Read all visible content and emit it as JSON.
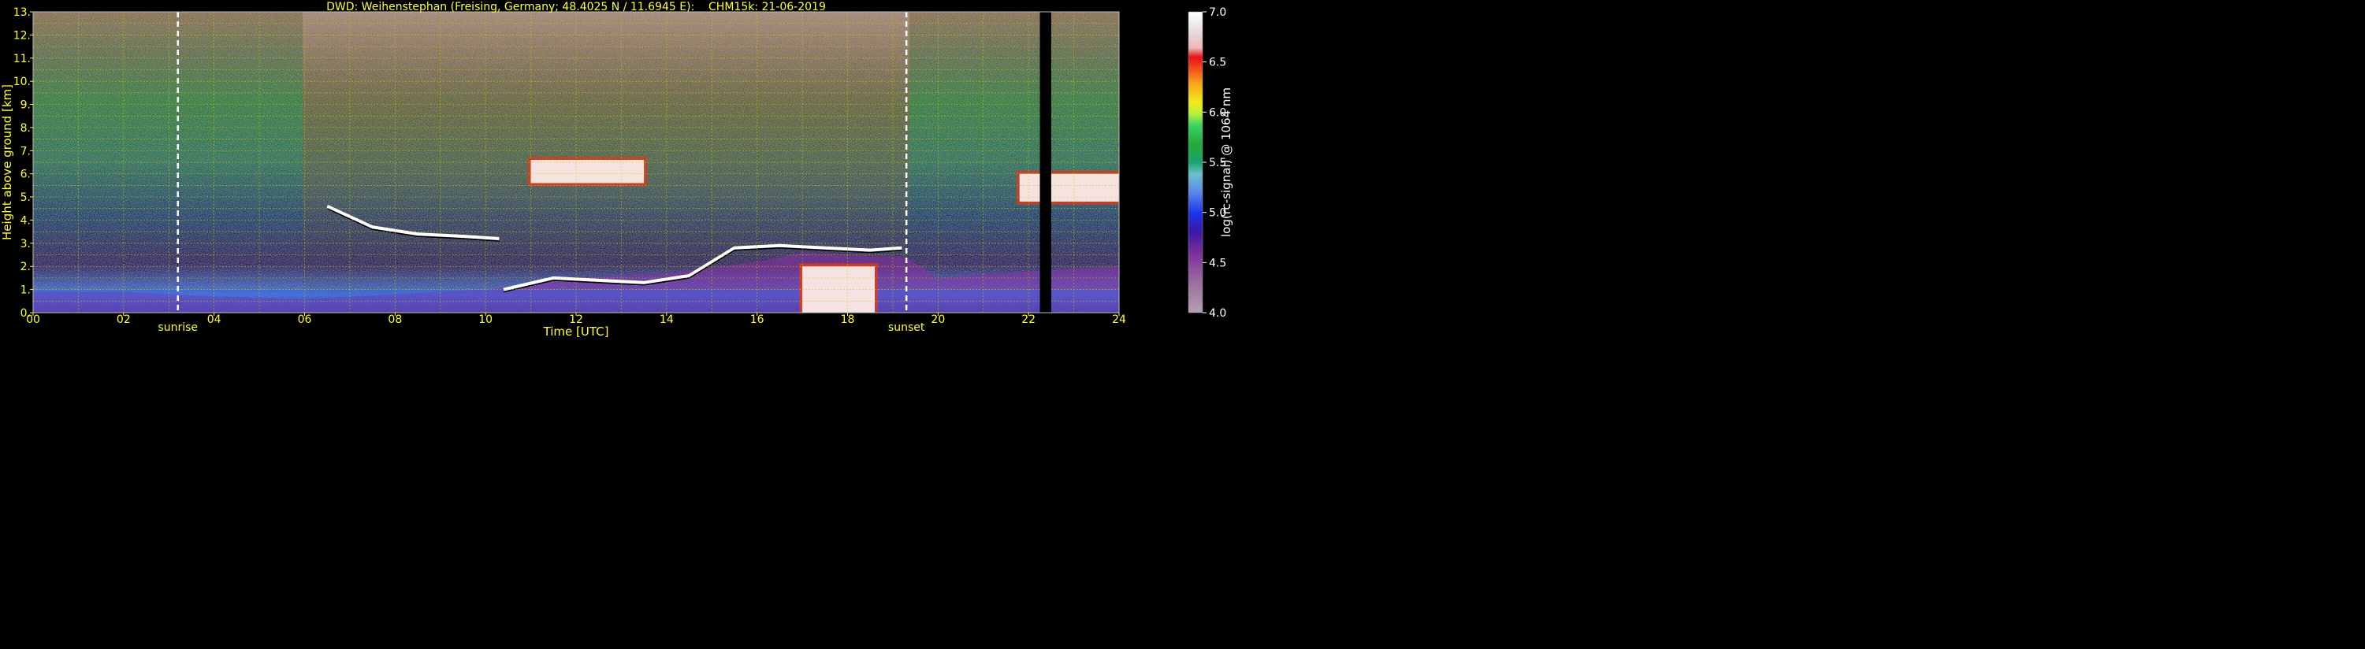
{
  "chart_data": {
    "type": "heatmap",
    "title": "DWD: Weihenstephan (Freising, Germany; 48.4025 N / 11.6945 E):    CHM15k: 21-06-2019",
    "xlabel": "Time [UTC]",
    "ylabel": "Height above ground [km]",
    "xlim": [
      0,
      24
    ],
    "ylim": [
      0,
      13
    ],
    "x_ticks": [
      "00",
      "02",
      "04",
      "06",
      "08",
      "10",
      "12",
      "14",
      "16",
      "18",
      "20",
      "22",
      "24"
    ],
    "y_ticks": [
      "0.",
      "1.",
      "2.",
      "3.",
      "4.",
      "5.",
      "6.",
      "7.",
      "8.",
      "9.",
      "10.",
      "11.",
      "12.",
      "13."
    ],
    "grid": true,
    "markers": [
      {
        "label": "sunrise",
        "x": 3.2
      },
      {
        "label": "sunset",
        "x": 19.3
      }
    ],
    "data_gap": [
      22.25,
      22.5
    ],
    "colorbar": {
      "label": "log(rc-signal) @ 1064 nm",
      "range": [
        4.0,
        7.0
      ],
      "ticks": [
        "4.0",
        "4.5",
        "5.0",
        "5.5",
        "6.0",
        "6.5",
        "7.0"
      ]
    },
    "layers": [
      {
        "kind": "boundary_layer",
        "x": [
          0,
          2,
          4,
          6,
          8,
          10,
          12,
          14,
          16,
          17,
          18,
          19.3,
          20,
          22,
          24
        ],
        "top_km": [
          0.9,
          0.9,
          0.7,
          0.6,
          0.8,
          1.0,
          1.5,
          1.7,
          2.2,
          2.6,
          2.5,
          2.4,
          1.5,
          1.8,
          2.0
        ]
      },
      {
        "kind": "cloud_base",
        "x": [
          6.5,
          7.5,
          8.5,
          9.5,
          10.3
        ],
        "base_km": [
          4.6,
          3.7,
          3.4,
          3.3,
          3.2
        ]
      },
      {
        "kind": "cloud_base",
        "x": [
          10.4,
          11.5,
          12.5,
          13.5,
          14.5,
          15.5,
          16.5,
          17.5,
          18.5,
          19.2
        ],
        "base_km": [
          1.0,
          1.5,
          1.4,
          1.3,
          1.6,
          2.8,
          2.9,
          2.8,
          2.7,
          2.8
        ]
      },
      {
        "kind": "cloud",
        "x": [
          11.0,
          13.5
        ],
        "top_km": 6.6,
        "base_km": 5.6
      },
      {
        "kind": "cloud",
        "x": [
          21.8,
          24
        ],
        "top_km": 6.0,
        "base_km": 4.8
      },
      {
        "kind": "cloud",
        "x": [
          17.0,
          18.6
        ],
        "top_km": 2.0,
        "base_km": 0.0
      }
    ]
  }
}
